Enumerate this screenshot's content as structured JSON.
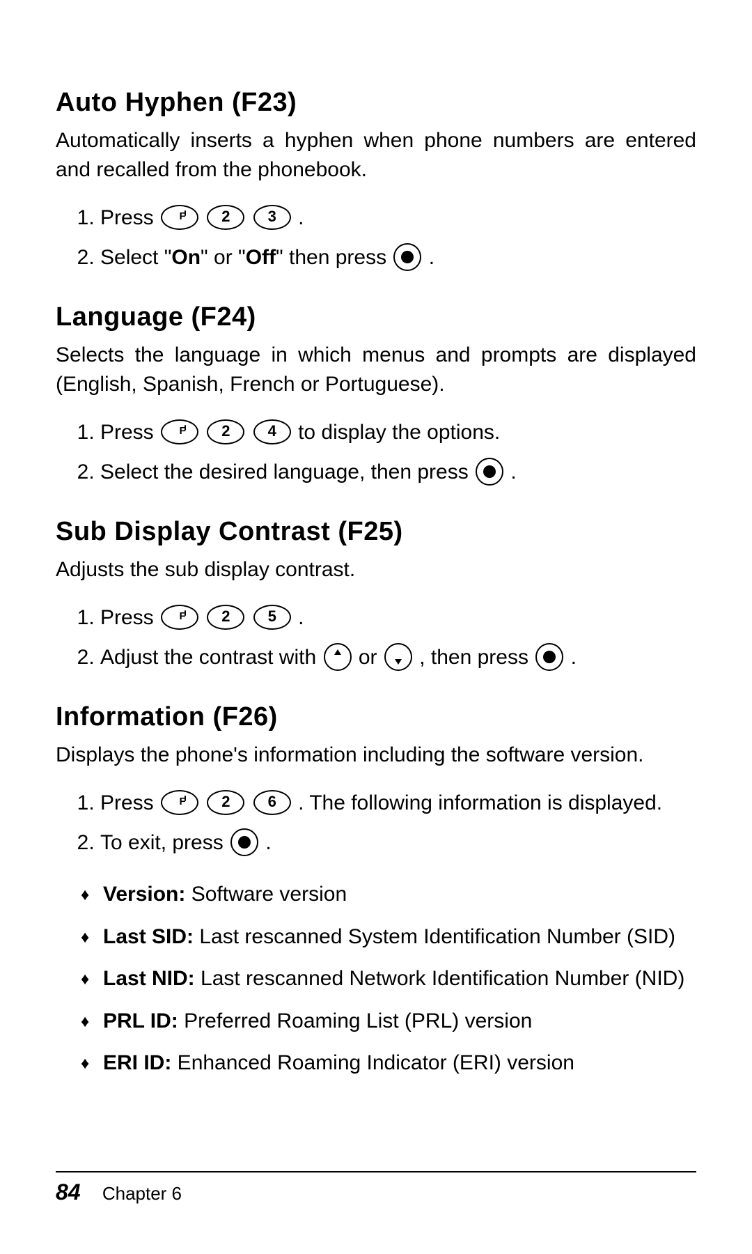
{
  "page_number": "84",
  "chapter_label": "Chapter 6",
  "sections": [
    {
      "heading": "Auto Hyphen (F23)",
      "desc": "Automatically inserts a hyphen when phone numbers are entered and recalled from the phonebook.",
      "steps": [
        {
          "pre": "Press ",
          "keys": [
            "F",
            "2",
            "3"
          ],
          "post": "."
        },
        {
          "pre": "Select \"",
          "b1": "On",
          "mid": "\" or \"",
          "b2": "Off",
          "post2": "\" then press ",
          "keys_end": [
            "OK"
          ],
          "tail": "."
        }
      ]
    },
    {
      "heading": "Language (F24)",
      "desc": "Selects the language in which menus and prompts are displayed (English, Spanish, French or Portuguese).",
      "steps": [
        {
          "pre": "Press ",
          "keys": [
            "F",
            "2",
            "4"
          ],
          "post": " to display the options."
        },
        {
          "pre": "Select the desired language, then press ",
          "keys": [
            "OK"
          ],
          "post": "."
        }
      ]
    },
    {
      "heading": "Sub Display Contrast (F25)",
      "desc": "Adjusts the sub display contrast.",
      "steps": [
        {
          "pre": "Press ",
          "keys": [
            "F",
            "2",
            "5"
          ],
          "post": "."
        },
        {
          "pre": "Adjust the contrast with ",
          "keys": [
            "UP"
          ],
          "mid": " or ",
          "keys2": [
            "DOWN"
          ],
          "post2": ", then press ",
          "keys_end": [
            "OK"
          ],
          "tail": "."
        }
      ]
    },
    {
      "heading": "Information (F26)",
      "desc": "Displays the phone's information including the software version.",
      "steps": [
        {
          "pre": "Press ",
          "keys": [
            "F",
            "2",
            "6"
          ],
          "post": ". The following information is displayed."
        },
        {
          "pre": "To exit, press ",
          "keys": [
            "OK"
          ],
          "post": "."
        }
      ],
      "info_items": [
        {
          "label": "Version:",
          "text": " Software version"
        },
        {
          "label": "Last SID:",
          "text": " Last rescanned System Identification Number (SID)"
        },
        {
          "label": "Last NID:",
          "text": " Last rescanned Network Identification Number (NID)"
        },
        {
          "label": "PRL ID:",
          "text": " Preferred Roaming List (PRL) version"
        },
        {
          "label": "ERI ID:",
          "text": " Enhanced Roaming Indicator (ERI) version"
        }
      ]
    }
  ]
}
